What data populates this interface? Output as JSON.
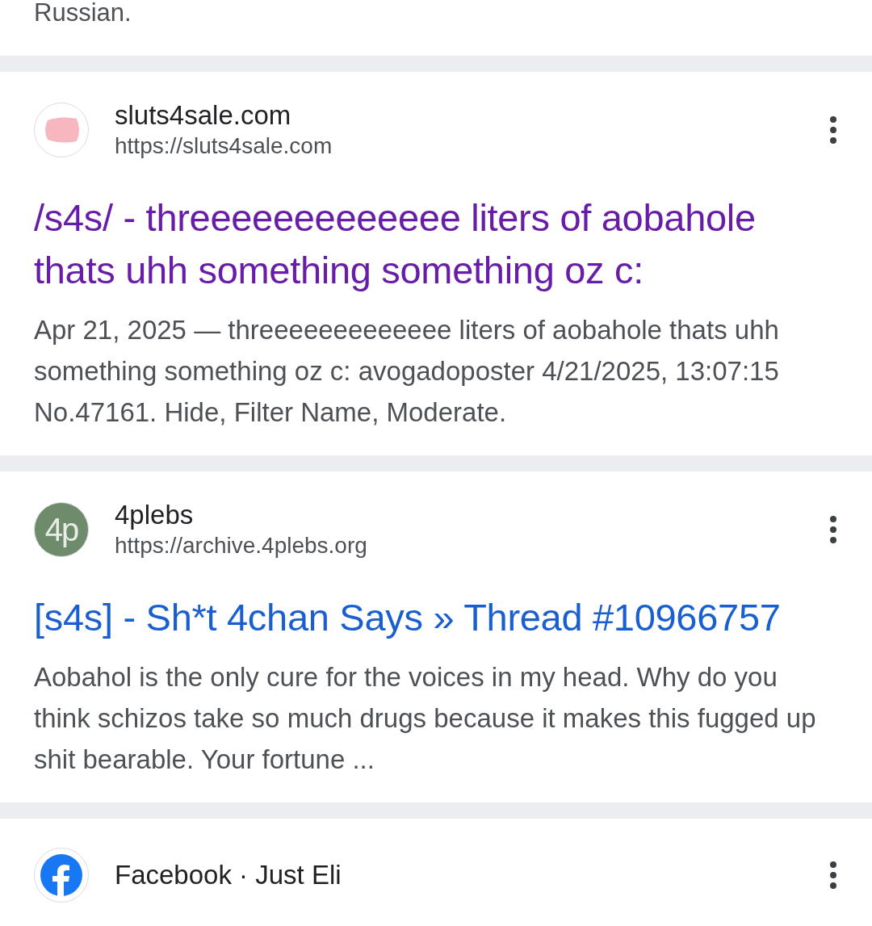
{
  "previous_snippet_tail": "Russian.",
  "results": [
    {
      "site": "sluts4sale.com",
      "url": "https://sluts4sale.com",
      "kind": "pink",
      "title": "/s4s/ - threeeeeeeeeeeee liters of aobahole thats uhh something something oz c:",
      "visited": true,
      "snippet": "Apr 21, 2025 — threeeeeeeeeeeee liters of aobahole thats uhh something something oz c: avogadoposter 4/21/2025, 13:07:15 No.47161. Hide, Filter Name, Moderate."
    },
    {
      "site": "4plebs",
      "url": "https://archive.4plebs.org",
      "kind": "letters",
      "favicon_text": "4p",
      "title": "[s4s] - Sh*t 4chan Says » Thread #10966757",
      "visited": false,
      "snippet": "Aobahol is the only cure for the voices in my head. Why do you think schizos take so much drugs because it makes this fugged up shit bearable. Your fortune ..."
    },
    {
      "site": "Facebook · Just Eli",
      "kind": "facebook"
    }
  ]
}
